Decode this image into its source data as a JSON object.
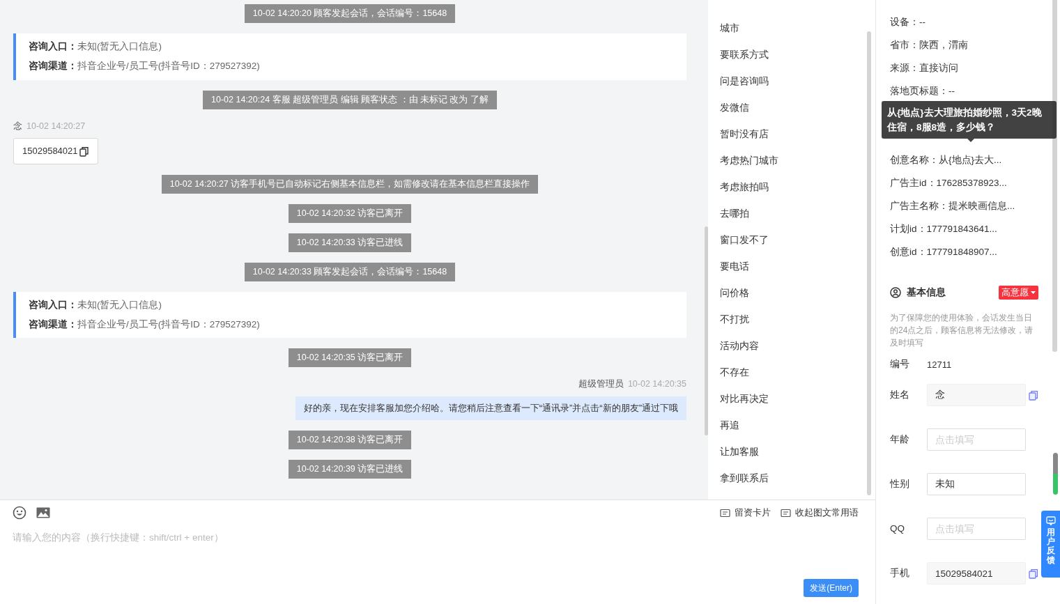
{
  "chat": {
    "messages": [
      {
        "kind": "system",
        "text": "10-02 14:20:20 顾客发起会话，会话编号：15648"
      },
      {
        "kind": "entry",
        "lines": [
          {
            "label": "咨询入口：",
            "value": "未知(暂无入口信息)"
          },
          {
            "label": "咨询渠道：",
            "value": "抖音企业号/员工号(抖音号ID：279527392)"
          }
        ]
      },
      {
        "kind": "system",
        "text": "10-02 14:20:24 客服 超级管理员 编辑 顾客状态 ：由 未标记 改为 了解"
      },
      {
        "kind": "visitor",
        "sender": "念",
        "time": "10-02 14:20:27",
        "text": "15029584021"
      },
      {
        "kind": "system",
        "text": "10-02 14:20:27 访客手机号已自动标记右侧基本信息栏，如需修改请在基本信息栏直接操作"
      },
      {
        "kind": "system",
        "text": "10-02 14:20:32 访客已离开"
      },
      {
        "kind": "system",
        "text": "10-02 14:20:33 访客已进线"
      },
      {
        "kind": "system",
        "text": "10-02 14:20:33 顾客发起会话，会话编号：15648"
      },
      {
        "kind": "entry",
        "lines": [
          {
            "label": "咨询入口：",
            "value": "未知(暂无入口信息)"
          },
          {
            "label": "咨询渠道：",
            "value": "抖音企业号/员工号(抖音号ID：279527392)"
          }
        ]
      },
      {
        "kind": "system",
        "text": "10-02 14:20:35 访客已离开"
      },
      {
        "kind": "agent",
        "sender": "超级管理员",
        "time": "10-02 14:20:35",
        "text": "好的亲，现在安排客服加您介绍哈。请您稍后注意查看一下“通讯录”并点击“新的朋友”通过下哦"
      },
      {
        "kind": "system",
        "text": "10-02 14:20:38 访客已离开"
      },
      {
        "kind": "system",
        "text": "10-02 14:20:39 访客已进线"
      }
    ]
  },
  "quick_replies": [
    "城市",
    "要联系方式",
    "问是咨询吗",
    "发微信",
    "暂时没有店",
    "考虑热门城市",
    "考虑旅拍吗",
    "去哪拍",
    "窗口发不了",
    "要电话",
    "问价格",
    "不打扰",
    "活动内容",
    "不存在",
    "对比再决定",
    "再追",
    "让加客服",
    "拿到联系后"
  ],
  "composer": {
    "tools_right": [
      "留资卡片",
      "收起图文常用语"
    ],
    "placeholder": "请输入您的内容（换行快捷键：shift/ctrl + enter）",
    "send_label": "发送(Enter)"
  },
  "visitor_info": {
    "rows_before": [
      "设备：--",
      "省市：陕西，渭南",
      "来源：直接访问",
      "落地页标题：--"
    ],
    "tooltip": "从{地点}去大理旅拍婚纱照，3天2晚住宿，8服8造，多少钱？",
    "rows_after": [
      "创意名称：从{地点}去大...",
      "广告主id：176285378923...",
      "广告主名称：提米映画信息...",
      "计划id：177791843641...",
      "创意id：177791848907..."
    ]
  },
  "basic_info": {
    "title": "基本信息",
    "intent_badge": "高意愿",
    "notice": "为了保障您的使用体验，会话发生当日的24点之后，顾客信息将无法修改，请及时填写",
    "fields": [
      {
        "kind": "static",
        "label": "编号",
        "value": "12711"
      },
      {
        "kind": "locked",
        "label": "姓名",
        "value": "念"
      },
      {
        "kind": "input",
        "label": "年龄",
        "placeholder": "点击填写"
      },
      {
        "kind": "input",
        "label": "性别",
        "value": "未知"
      },
      {
        "kind": "input",
        "label": "QQ",
        "placeholder": "点击填写"
      },
      {
        "kind": "locked",
        "label": "手机",
        "value": "15029584021"
      }
    ]
  },
  "feedback_button": "用户反馈"
}
